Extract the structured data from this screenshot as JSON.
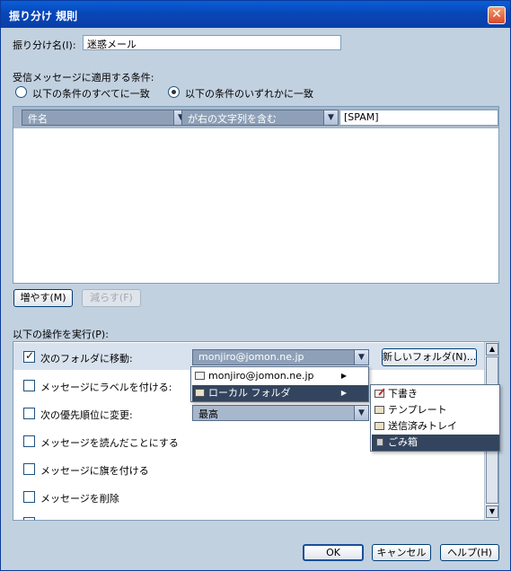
{
  "window": {
    "title": "振り分け 規則",
    "close_glyph": "✕"
  },
  "filter_name": {
    "label": "振り分け名(I):",
    "value": "迷惑メール"
  },
  "conditions": {
    "heading": "受信メッセージに適用する条件:",
    "match_all": "以下の条件のすべてに一致",
    "match_any": "以下の条件のいずれかに一致",
    "selected": "match_any",
    "rows": [
      {
        "field": "件名",
        "operator": "が右の文字列を含む",
        "value": "[SPAM]"
      }
    ],
    "add_button": "増やす(M)",
    "remove_button": "減らす(F)"
  },
  "actions": {
    "heading": "以下の操作を実行(P):",
    "items": [
      {
        "label": "次のフォルダに移動:",
        "checked": true
      },
      {
        "label": "メッセージにラベルを付ける:",
        "checked": false
      },
      {
        "label": "次の優先順位に変更:",
        "checked": false
      },
      {
        "label": "メッセージを読んだことにする",
        "checked": false
      },
      {
        "label": "メッセージに旗を付ける",
        "checked": false
      },
      {
        "label": "メッセージを削除",
        "checked": false
      }
    ],
    "folder_select_value": "monjiro@jomon.ne.jp",
    "new_folder_button": "新しいフォルダ(N)...",
    "priority_value": "最高"
  },
  "folder_menu": {
    "items": [
      {
        "label": "monjiro@jomon.ne.jp",
        "icon": "mail-account-icon",
        "highlighted": false
      },
      {
        "label": "ローカル フォルダ",
        "icon": "local-folders-icon",
        "highlighted": true
      }
    ],
    "submenu_arrow": "▶"
  },
  "local_folders_submenu": {
    "items": [
      {
        "label": "下書き",
        "icon": "drafts-folder-icon",
        "highlighted": false
      },
      {
        "label": "テンプレート",
        "icon": "templates-folder-icon",
        "highlighted": false
      },
      {
        "label": "送信済みトレイ",
        "icon": "sent-folder-icon",
        "highlighted": false
      },
      {
        "label": "ごみ箱",
        "icon": "trash-folder-icon",
        "highlighted": true
      }
    ]
  },
  "footer": {
    "ok": "OK",
    "cancel": "キャンセル",
    "help": "ヘルプ(H)"
  },
  "colors": {
    "titlebar": "#0a5fd8",
    "dialog_bg": "#c2d1e0",
    "highlight": "#33455e"
  }
}
